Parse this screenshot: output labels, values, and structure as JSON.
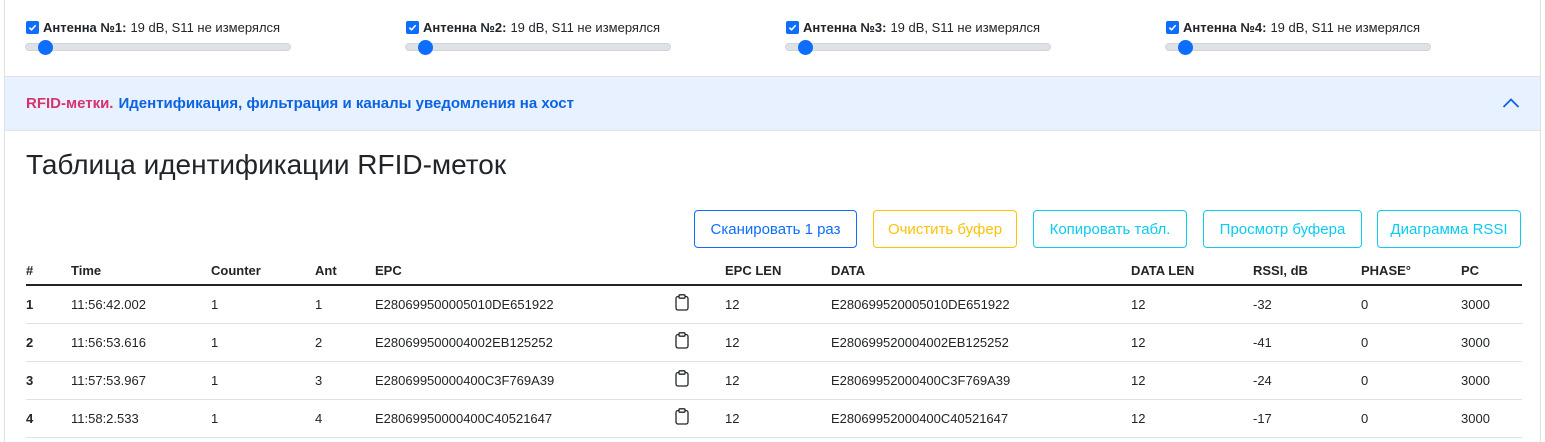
{
  "antennas": [
    {
      "name": "Антенна №1:",
      "info": "19 dB, S11 не измерялся",
      "checked": true,
      "level": 0.05
    },
    {
      "name": "Антенна №2:",
      "info": "19 dB, S11 не измерялся",
      "checked": true,
      "level": 0.05
    },
    {
      "name": "Антенна №3:",
      "info": "19 dB, S11 не измерялся",
      "checked": true,
      "level": 0.05
    },
    {
      "name": "Антенна №4:",
      "info": "19 dB, S11 не измерялся",
      "checked": true,
      "level": 0.05
    }
  ],
  "accordion": {
    "title_part1": "RFID-метки.",
    "title_part2": "Идентификация, фильтрация и каналы уведомления на хост"
  },
  "section": {
    "title": "Таблица идентификации RFID-меток"
  },
  "buttons": {
    "scan_once": "Сканировать 1 раз",
    "clear_buffer": "Очистить буфер",
    "copy_table": "Копировать табл.",
    "view_buffer": "Просмотр буфера",
    "rssi_chart": "Диаграмма RSSI"
  },
  "table": {
    "headers": [
      "#",
      "Time",
      "Counter",
      "Ant",
      "EPC",
      "",
      "EPC LEN",
      "DATA",
      "DATA LEN",
      "RSSI, dB",
      "PHASE°",
      "PC"
    ],
    "rows": [
      {
        "idx": "1",
        "time": "11:56:42.002",
        "counter": "1",
        "ant": "1",
        "epc": "E280699500005010DE651922",
        "epc_len": "12",
        "data": "E280699520005010DE651922",
        "data_len": "12",
        "rssi": "-32",
        "phase": "0",
        "pc": "3000"
      },
      {
        "idx": "2",
        "time": "11:56:53.616",
        "counter": "1",
        "ant": "2",
        "epc": "E280699500004002EB125252",
        "epc_len": "12",
        "data": "E280699520004002EB125252",
        "data_len": "12",
        "rssi": "-41",
        "phase": "0",
        "pc": "3000"
      },
      {
        "idx": "3",
        "time": "11:57:53.967",
        "counter": "1",
        "ant": "3",
        "epc": "E28069950000400C3F769A39",
        "epc_len": "12",
        "data": "E28069952000400C3F769A39",
        "data_len": "12",
        "rssi": "-24",
        "phase": "0",
        "pc": "3000"
      },
      {
        "idx": "4",
        "time": "11:58:2.533",
        "counter": "1",
        "ant": "4",
        "epc": "E28069950000400C40521647",
        "epc_len": "12",
        "data": "E28069952000400C40521647",
        "data_len": "12",
        "rssi": "-17",
        "phase": "0",
        "pc": "3000"
      }
    ]
  },
  "icons": {
    "checkbox": "check-icon",
    "accordion_toggle": "chevron-up-icon",
    "copy": "clipboard-icon"
  },
  "colors": {
    "primary": "#0d6efd",
    "warning": "#ffc107",
    "info": "#0dcaf0",
    "accent_pink": "#d6336c",
    "accordion_bg": "#e7f1ff"
  }
}
